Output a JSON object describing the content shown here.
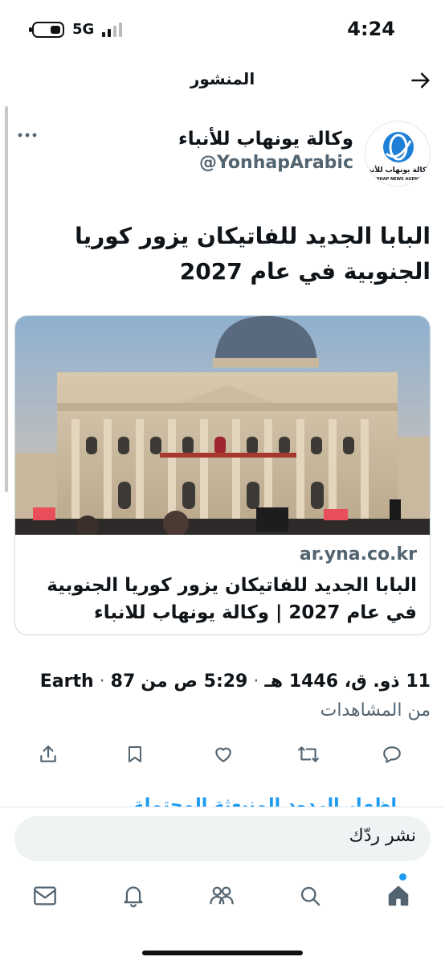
{
  "status_bar": {
    "time": "4:24",
    "network": "5G"
  },
  "header": {
    "title": "المنشور"
  },
  "post": {
    "author": {
      "display_name": "وكالة يونهاب للأنباء",
      "handle": "@YonhapArabic",
      "avatar_text": "وكالة يونهاب للأنباء",
      "avatar_subtext": "YONHAP NEWS AGENCY"
    },
    "text": "البابا الجديد للفاتيكان يزور كوريا الجنوبية في عام 2027",
    "card": {
      "domain": "ar.yna.co.kr",
      "title": "البابا الجديد للفاتيكان يزور كوريا الجنوبية في عام 2027 | وكالة يونهاب للانباء"
    },
    "meta": {
      "timestamp": "5:29 ص من",
      "date": "11 ذو. ق، 1446 هـ",
      "source": "Earth",
      "views_count": "87",
      "views_label": "من المشاهدات"
    },
    "peek_text": "إظهار الردود المنبعثة المحتملة"
  },
  "reply": {
    "placeholder": "نشر ردّك"
  },
  "colors": {
    "accent": "#1d9bf0",
    "text": "#0f1419",
    "secondary": "#536471"
  }
}
